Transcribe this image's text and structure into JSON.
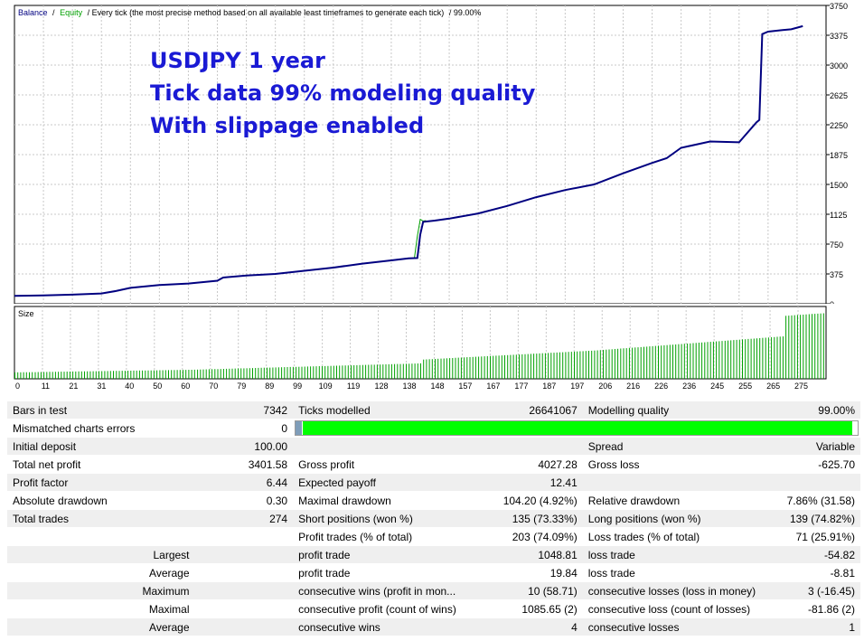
{
  "colors": {
    "balance": "#000080",
    "equity": "#00a000",
    "size_bars": "#00a000",
    "annotation": "#1a1ad4",
    "quality_fill": "#00ff00",
    "grid": "#c8c8c8"
  },
  "chart_data": [
    {
      "type": "line",
      "legend": {
        "balance": "Balance",
        "separator": "/",
        "equity": "Equity",
        "description": "/ Every tick (the most precise method based on all available least timeframes to generate each tick)",
        "quality": "/ 99.00%"
      },
      "annotations": [
        "USDJPY 1 year",
        "Tick data 99% modeling quality",
        "With slippage enabled"
      ],
      "ylim": [
        0,
        3750
      ],
      "yticks": [
        "3750",
        "3375",
        "3000",
        "2625",
        "2250",
        "1875",
        "1500",
        "1125",
        "750",
        "375",
        "0"
      ],
      "xlim": [
        0,
        280
      ],
      "grid": true,
      "series": [
        {
          "name": "Balance",
          "x": [
            0,
            10,
            20,
            30,
            35,
            40,
            50,
            60,
            70,
            72,
            80,
            90,
            100,
            110,
            120,
            130,
            136,
            139,
            140,
            141,
            145,
            150,
            160,
            170,
            180,
            190,
            200,
            210,
            220,
            225,
            230,
            240,
            250,
            256,
            257,
            258,
            260,
            265,
            268,
            272
          ],
          "y": [
            100,
            105,
            115,
            130,
            160,
            200,
            235,
            255,
            290,
            330,
            355,
            375,
            415,
            455,
            505,
            545,
            570,
            575,
            870,
            1030,
            1045,
            1070,
            1135,
            1230,
            1340,
            1430,
            1500,
            1640,
            1770,
            1830,
            1960,
            2040,
            2030,
            2280,
            2310,
            3390,
            3420,
            3440,
            3450,
            3490
          ]
        },
        {
          "name": "Equity",
          "x": [
            138,
            139,
            140,
            141,
            142
          ],
          "y": [
            580,
            850,
            1060,
            1040,
            1045
          ]
        }
      ]
    },
    {
      "type": "bar",
      "title": "Size",
      "xticks": [
        "0",
        "11",
        "21",
        "31",
        "40",
        "50",
        "60",
        "70",
        "79",
        "89",
        "99",
        "109",
        "119",
        "128",
        "138",
        "148",
        "157",
        "167",
        "177",
        "187",
        "197",
        "206",
        "216",
        "226",
        "236",
        "245",
        "255",
        "265",
        "275"
      ],
      "xlim": [
        0,
        280
      ],
      "values": {
        "x": [
          0,
          60,
          140,
          141,
          200,
          265,
          266,
          279
        ],
        "y": [
          0.5,
          0.7,
          1.2,
          1.5,
          2.2,
          3.3,
          4.9,
          5.1
        ]
      }
    }
  ],
  "report": {
    "rows": [
      [
        "Bars in test",
        "7342",
        "Ticks modelled",
        "26641067",
        "Modelling quality",
        "99.00%"
      ],
      [
        "Mismatched charts errors",
        "0",
        "",
        "",
        "",
        ""
      ],
      [
        "Initial deposit",
        "100.00",
        "",
        "",
        "Spread",
        "Variable"
      ],
      [
        "Total net profit",
        "3401.58",
        "Gross profit",
        "4027.28",
        "Gross loss",
        "-625.70"
      ],
      [
        "Profit factor",
        "6.44",
        "Expected payoff",
        "12.41",
        "",
        ""
      ],
      [
        "Absolute drawdown",
        "0.30",
        "Maximal drawdown",
        "104.20 (4.92%)",
        "Relative drawdown",
        "7.86% (31.58)"
      ],
      [
        "Total trades",
        "274",
        "Short positions (won %)",
        "135 (73.33%)",
        "Long positions (won %)",
        "139 (74.82%)"
      ],
      [
        "",
        "",
        "Profit trades (% of total)",
        "203 (74.09%)",
        "Loss trades (% of total)",
        "71 (25.91%)"
      ],
      [
        "Largest",
        "",
        "profit trade",
        "1048.81",
        "loss trade",
        "-54.82"
      ],
      [
        "Average",
        "",
        "profit trade",
        "19.84",
        "loss trade",
        "-8.81"
      ],
      [
        "Maximum",
        "",
        "consecutive wins (profit in mon...",
        "10 (58.71)",
        "consecutive losses (loss in money)",
        "3 (-16.45)"
      ],
      [
        "Maximal",
        "",
        "consecutive profit (count of wins)",
        "1085.65 (2)",
        "consecutive loss (count of losses)",
        "-81.86 (2)"
      ],
      [
        "Average",
        "",
        "consecutive wins",
        "4",
        "consecutive losses",
        "1"
      ]
    ],
    "modelling_quality_fill": 0.99
  }
}
